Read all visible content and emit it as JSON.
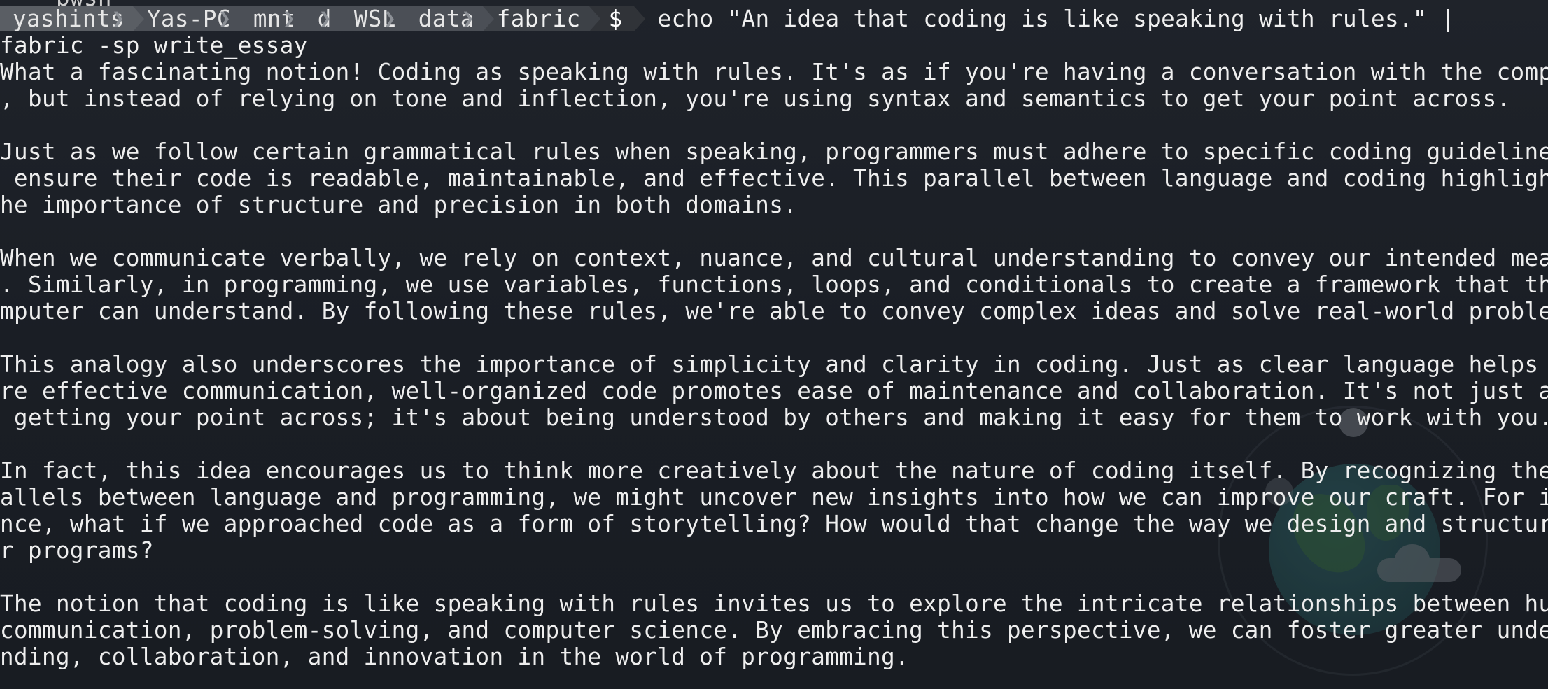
{
  "terminal": {
    "previous_line": "    pwsh    ",
    "prompt": {
      "segments": [
        "yashints",
        "Yas-PC",
        "mnt",
        "d",
        "WSL",
        "data",
        "fabric"
      ],
      "symbol": "$"
    },
    "command_line_1": "echo \"An idea that coding is like speaking with rules.\" |",
    "command_line_2": "fabric -sp write_essay",
    "output_lines": [
      "What a fascinating notion! Coding as speaking with rules. It's as if you're having a conversation with the computer",
      ", but instead of relying on tone and inflection, you're using syntax and semantics to get your point across.",
      "",
      "Just as we follow certain grammatical rules when speaking, programmers must adhere to specific coding guidelines to",
      " ensure their code is readable, maintainable, and effective. This parallel between language and coding highlights t",
      "he importance of structure and precision in both domains.",
      "",
      "When we communicate verbally, we rely on context, nuance, and cultural understanding to convey our intended meaning",
      ". Similarly, in programming, we use variables, functions, loops, and conditionals to create a framework that the co",
      "mputer can understand. By following these rules, we're able to convey complex ideas and solve real-world problems.",
      "",
      "This analogy also underscores the importance of simplicity and clarity in coding. Just as clear language helps ensu",
      "re effective communication, well-organized code promotes ease of maintenance and collaboration. It's not just about",
      " getting your point across; it's about being understood by others and making it easy for them to work with you.",
      "",
      "In fact, this idea encourages us to think more creatively about the nature of coding itself. By recognizing the par",
      "allels between language and programming, we might uncover new insights into how we can improve our craft. For insta",
      "nce, what if we approached code as a form of storytelling? How would that change the way we design and structure ou",
      "r programs?",
      "",
      "The notion that coding is like speaking with rules invites us to explore the intricate relationships between human",
      "communication, problem-solving, and computer science. By embracing this perspective, we can foster greater understa",
      "nding, collaboration, and innovation in the world of programming."
    ]
  },
  "colors": {
    "background": "#1b1f26",
    "text": "#eeeeee",
    "prompt_segment": "#4b4f56",
    "prompt_separator": "#8c9096"
  },
  "icons": {
    "separator": "powerline-chevron-icon",
    "wallpaper": "globe-wallpaper-icon"
  }
}
